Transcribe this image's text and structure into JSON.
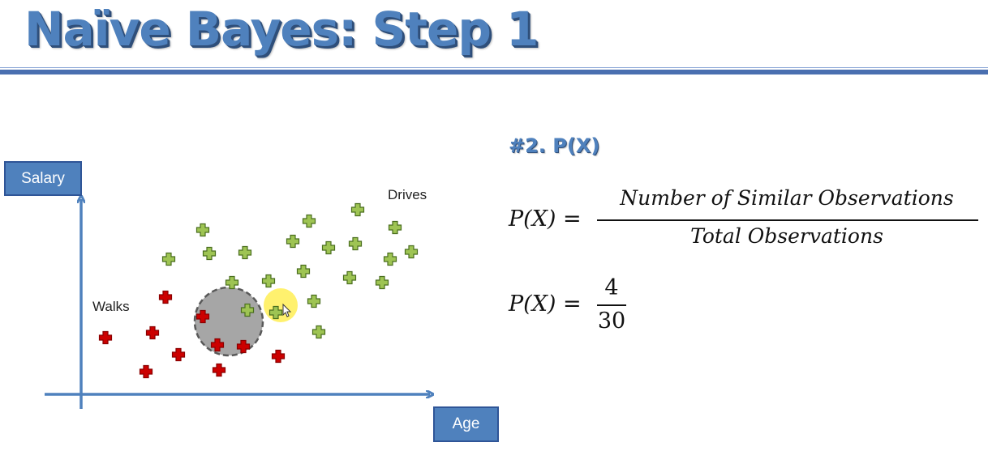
{
  "slide": {
    "title": "Naïve Bayes: Step 1",
    "subtitle": "#2. P(X)"
  },
  "plot": {
    "y_axis_label": "Salary",
    "x_axis_label": "Age",
    "class_walks_label": "Walks",
    "class_drives_label": "Drives",
    "colors": {
      "walks": "#cc0000",
      "drives": "#9ec453",
      "axis": "#4f81bd",
      "circle_fill": "#a6a6a6",
      "circle_stroke": "#595959",
      "cursor_highlight": "#ffee55"
    }
  },
  "formula1": {
    "lhs": "P(X) =",
    "numerator": "Number of Similar Observations",
    "denominator": "Total Observations"
  },
  "formula2": {
    "lhs": "P(X) =",
    "numerator": "4",
    "denominator": "30"
  }
}
